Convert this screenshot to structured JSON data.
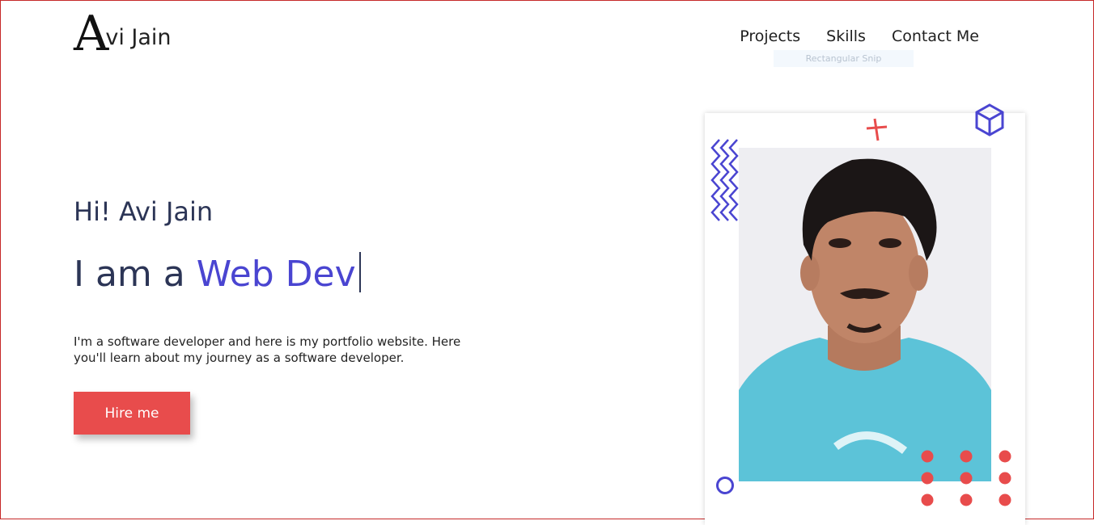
{
  "header": {
    "logo_initial": "A",
    "logo_name": "vi Jain",
    "nav": {
      "projects": "Projects",
      "skills": "Skills",
      "contact": "Contact Me"
    },
    "snip_tooltip": "Rectangular Snip"
  },
  "hero": {
    "greeting": "Hi! Avi Jain",
    "headline_prefix": "I am a",
    "headline_role": "Web Dev",
    "intro": "I'm a software developer and here is my portfolio website. Here you'll learn about my journey as a software developer.",
    "cta_label": "Hire me"
  },
  "colors": {
    "accent": "#4a45d1",
    "cta": "#e84c4c",
    "heading": "#2c3556"
  },
  "icons": {
    "cube": "cube-icon",
    "plus": "plus-icon",
    "zigzag": "zigzag-icon",
    "circle": "circle-icon",
    "dots": "dots-grid-icon"
  }
}
